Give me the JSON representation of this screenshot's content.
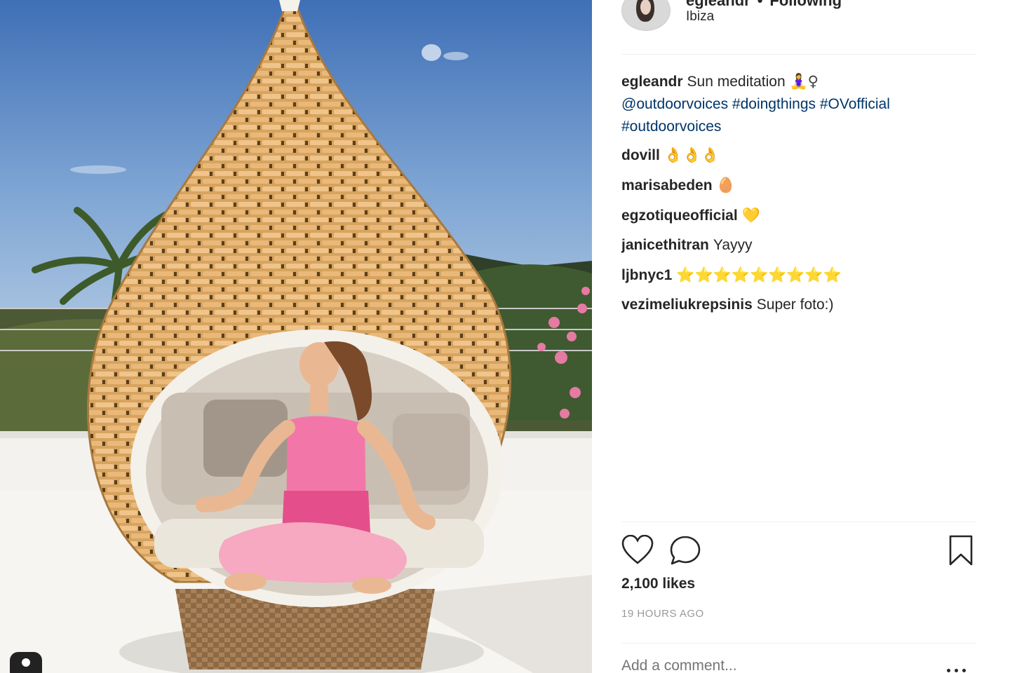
{
  "post": {
    "username": "egleandr",
    "separator": "•",
    "follow_status": "Following",
    "location": "Ibiza"
  },
  "comments": [
    {
      "user": "egleandr",
      "text": "Sun meditation",
      "emoji": "🧘‍♀️♀"
    },
    {
      "user": "",
      "links": [
        "@outdoorvoices",
        "#doingthings",
        "#OVofficial",
        "#outdoorvoices"
      ]
    },
    {
      "user": "dovill",
      "text": "",
      "emoji": "👌👌👌"
    },
    {
      "user": "marisabeden",
      "text": "",
      "emoji": "🥚"
    },
    {
      "user": "egzotiqueofficial",
      "text": "",
      "emoji": "💛"
    },
    {
      "user": "janicethitran",
      "text": "Yayyy",
      "emoji": ""
    },
    {
      "user": "ljbnyc1",
      "text": "",
      "emoji": "⭐⭐⭐⭐⭐⭐⭐⭐⭐"
    },
    {
      "user": "vezimeliukrepsinis",
      "text": "Super foto:)",
      "emoji": ""
    }
  ],
  "actions": {
    "likes": "2,100 likes",
    "timestamp": "19 HOURS AGO",
    "comment_placeholder": "Add a comment...",
    "icons": [
      "heart-icon",
      "comment-icon",
      "bookmark-icon",
      "more-options-icon"
    ]
  },
  "colors": {
    "link": "#003569",
    "text": "#262626",
    "muted": "#999999",
    "divider": "#efefef"
  }
}
